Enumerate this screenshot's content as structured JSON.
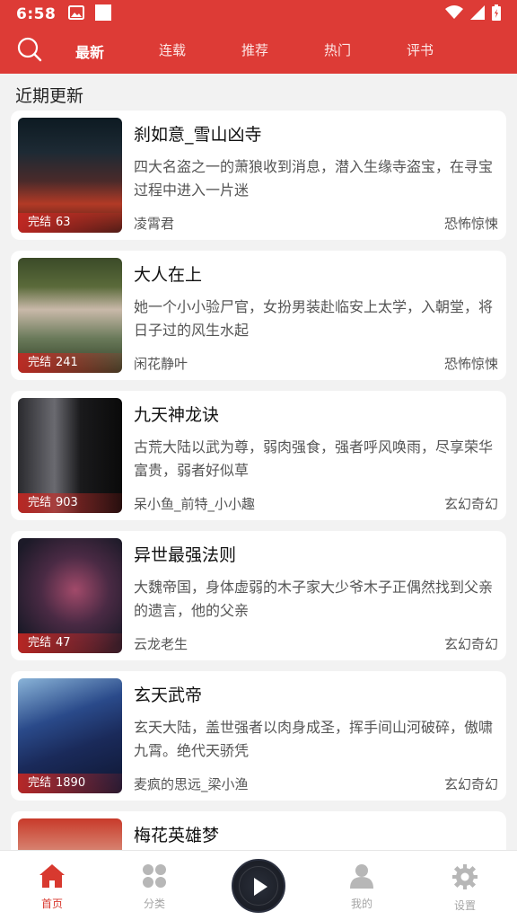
{
  "status": {
    "time": "6:58"
  },
  "nav": {
    "tabs": [
      {
        "label": "最新",
        "active": true
      },
      {
        "label": "连载",
        "active": false
      },
      {
        "label": "推荐",
        "active": false
      },
      {
        "label": "热门",
        "active": false
      },
      {
        "label": "评书",
        "active": false
      }
    ]
  },
  "section": {
    "title": "近期更新"
  },
  "books": [
    {
      "title": "刹如意_雪山凶寺",
      "desc": "四大名盗之一的萧狼收到消息，潜入生缘寺盗宝，在寻宝过程中进入一片迷",
      "author": "凌霄君",
      "genre": "恐怖惊悚",
      "status": "完结",
      "count": "63"
    },
    {
      "title": "大人在上",
      "desc": "她一个小小验尸官，女扮男装赴临安上太学，入朝堂，将日子过的风生水起",
      "author": "闲花静叶",
      "genre": "恐怖惊悚",
      "status": "完结",
      "count": "241"
    },
    {
      "title": "九天神龙诀",
      "desc": "古荒大陆以武为尊，弱肉强食，强者呼风唤雨，尽享荣华富贵，弱者好似草",
      "author": "呆小鱼_前特_小小趣",
      "genre": "玄幻奇幻",
      "status": "完结",
      "count": "903"
    },
    {
      "title": "异世最强法则",
      "desc": "大魏帝国，身体虚弱的木子家大少爷木子正偶然找到父亲的遗言，他的父亲",
      "author": "云龙老生",
      "genre": "玄幻奇幻",
      "status": "完结",
      "count": "47"
    },
    {
      "title": "玄天武帝",
      "desc": "玄天大陆，盖世强者以肉身成圣，挥手间山河破碎，傲啸九霄。绝代天骄凭",
      "author": "麦疯的思远_梁小渔",
      "genre": "玄幻奇幻",
      "status": "完结",
      "count": "1890"
    },
    {
      "title": "梅花英雄梦",
      "desc": "",
      "author": "",
      "genre": "",
      "status": "",
      "count": ""
    }
  ],
  "bottom_nav": {
    "items": [
      {
        "label": "首页",
        "icon": "home-icon",
        "active": true
      },
      {
        "label": "分类",
        "icon": "category-icon",
        "active": false
      },
      {
        "label": "我的",
        "icon": "profile-icon",
        "active": false
      },
      {
        "label": "设置",
        "icon": "settings-icon",
        "active": false
      }
    ]
  },
  "colors": {
    "brand": "#dd3b36",
    "active_tab": "#d8392f",
    "inactive_icon": "#b7b7b7"
  }
}
